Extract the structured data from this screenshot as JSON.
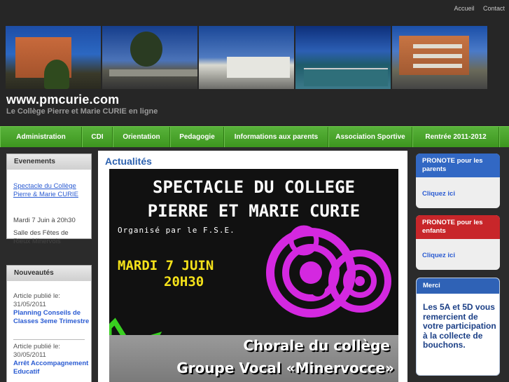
{
  "header": {
    "top_links": [
      "Accueil",
      "Contact"
    ],
    "site_title": "www.pmcurie.com",
    "site_subtitle": "Le Collège Pierre et Marie CURIE en ligne"
  },
  "nav": [
    "Administration",
    "CDI",
    "Orientation",
    "Pedagogie",
    "Informations aux parents",
    "Association Sportive",
    "Rentrée 2011-2012"
  ],
  "evenements": {
    "title": "Evenements",
    "link": "Spectacle du Collège Pierre & Marie CURIE",
    "date": "Mardi 7 Juin à 20h30",
    "place": "Salle des Fêtes de Rieux Minervois"
  },
  "nouveautes": {
    "title": "Nouveautés",
    "items": [
      {
        "meta": "Article publié le: 31/05/2011",
        "title": "Planning Conseils de Classes 3eme Trimestre"
      },
      {
        "meta": "Article publié le: 30/05/2011",
        "title": "Arrêt Accompagnement Educatif"
      }
    ]
  },
  "main": {
    "title": "Actualités",
    "poster": {
      "line1": "SPECTACLE DU COLLEGE",
      "line2": "PIERRE ET MARIE CURIE",
      "organizer": "Organisé par le F.S.E.",
      "date": "MARDI 7 JUIN",
      "time": "20H30",
      "choir1": "Chorale du collège",
      "choir2": "Groupe Vocal «Minervocce»"
    }
  },
  "right": {
    "pronote_parents": {
      "title": "PRONOTE pour les parents",
      "link": "Cliquez ici"
    },
    "pronote_enfants": {
      "title": "PRONOTE pour les enfants",
      "link": "Cliquez ici"
    },
    "merci": {
      "title": "Merci",
      "text": "Les 5A et 5D vous remercient de votre participation à la collecte de bouchons."
    }
  },
  "colors": {
    "nav_green": "#48a42a",
    "link_blue": "#2a5bd2",
    "pronote_blue": "#3268c4",
    "pronote_red": "#c8262a",
    "merci_blue": "#2f62b6",
    "poster_magenta": "#d428e0",
    "poster_green": "#38d020",
    "poster_yellow": "#f5e21a"
  }
}
